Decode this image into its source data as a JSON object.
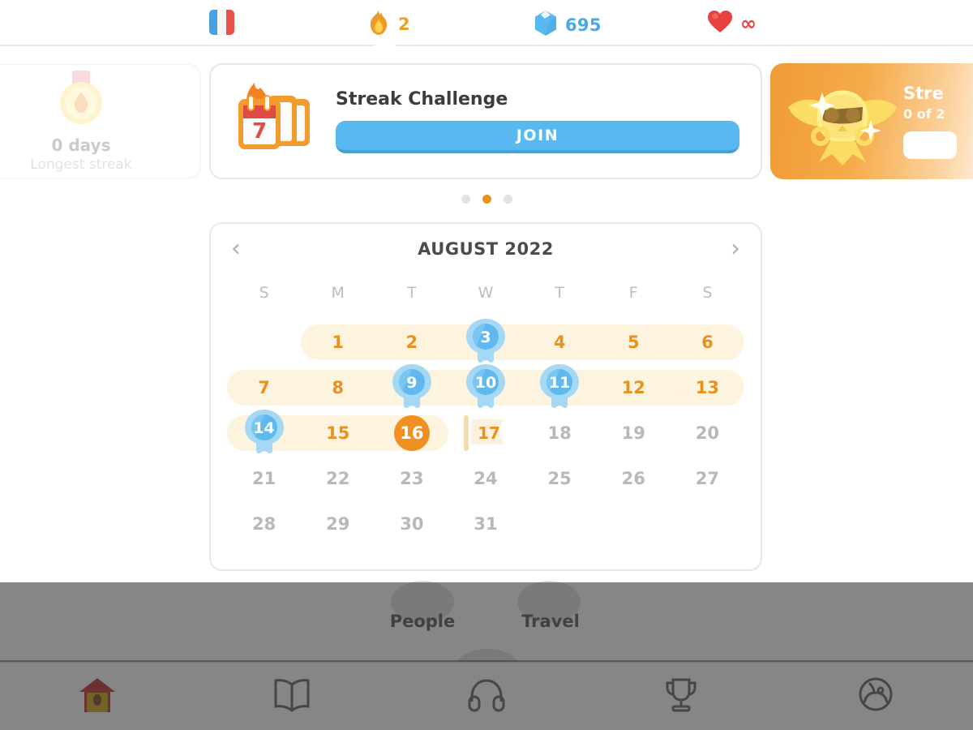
{
  "topbar": {
    "language_flag": "france-flag-icon",
    "streak": {
      "icon": "flame-icon",
      "value": "2"
    },
    "gems": {
      "icon": "gem-icon",
      "value": "695"
    },
    "hearts": {
      "icon": "heart-icon",
      "value": "∞"
    }
  },
  "carousel": {
    "left_card": {
      "icon": "medal-flame-icon",
      "title": "0 days",
      "subtitle": "Longest streak"
    },
    "mid_card": {
      "icon": "calendar-7-icon",
      "title": "Streak Challenge",
      "join_label": "JOIN"
    },
    "right_card": {
      "icon": "golden-winged-owl-icon",
      "title": "Stre",
      "subtitle": "0 of 2"
    },
    "dots": [
      {
        "active": false
      },
      {
        "active": true
      },
      {
        "active": false
      }
    ]
  },
  "calendar": {
    "prev_label": "‹",
    "next_label": "›",
    "month_title": "AUGUST 2022",
    "weekday_headers": [
      "S",
      "M",
      "T",
      "W",
      "T",
      "F",
      "S"
    ],
    "weeks": [
      [
        {
          "day": "",
          "type": "empty"
        },
        {
          "day": "1",
          "type": "streak"
        },
        {
          "day": "2",
          "type": "streak"
        },
        {
          "day": "3",
          "type": "freeze"
        },
        {
          "day": "4",
          "type": "streak"
        },
        {
          "day": "5",
          "type": "streak"
        },
        {
          "day": "6",
          "type": "streak"
        }
      ],
      [
        {
          "day": "7",
          "type": "streak"
        },
        {
          "day": "8",
          "type": "streak"
        },
        {
          "day": "9",
          "type": "freeze"
        },
        {
          "day": "10",
          "type": "freeze"
        },
        {
          "day": "11",
          "type": "freeze"
        },
        {
          "day": "12",
          "type": "streak"
        },
        {
          "day": "13",
          "type": "streak"
        }
      ],
      [
        {
          "day": "14",
          "type": "freeze"
        },
        {
          "day": "15",
          "type": "streak"
        },
        {
          "day": "16",
          "type": "today"
        },
        {
          "day": "17",
          "type": "goal"
        },
        {
          "day": "18",
          "type": "plain"
        },
        {
          "day": "19",
          "type": "plain"
        },
        {
          "day": "20",
          "type": "plain"
        }
      ],
      [
        {
          "day": "21",
          "type": "plain"
        },
        {
          "day": "22",
          "type": "plain"
        },
        {
          "day": "23",
          "type": "plain"
        },
        {
          "day": "24",
          "type": "plain"
        },
        {
          "day": "25",
          "type": "plain"
        },
        {
          "day": "26",
          "type": "plain"
        },
        {
          "day": "27",
          "type": "plain"
        }
      ],
      [
        {
          "day": "28",
          "type": "plain"
        },
        {
          "day": "29",
          "type": "plain"
        },
        {
          "day": "30",
          "type": "plain"
        },
        {
          "day": "31",
          "type": "plain"
        },
        {
          "day": "",
          "type": "empty"
        },
        {
          "day": "",
          "type": "empty"
        },
        {
          "day": "",
          "type": "empty"
        }
      ]
    ]
  },
  "background_path": {
    "skill_labels": [
      "People",
      "Travel"
    ]
  },
  "bottom_nav": [
    {
      "icon": "birdhouse-icon",
      "active": true
    },
    {
      "icon": "book-icon",
      "active": false
    },
    {
      "icon": "headphones-icon",
      "active": false
    },
    {
      "icon": "trophy-icon",
      "active": false
    },
    {
      "icon": "owl-profile-icon",
      "active": false
    }
  ],
  "colors": {
    "streak_orange": "#e8921e",
    "today_orange": "#ef9021",
    "band_cream": "#fdf4e0",
    "freeze_blue": "#8fcdf2",
    "gem_blue": "#4aa8e8",
    "heart_red": "#e8413f",
    "join_blue": "#58b9f0"
  }
}
